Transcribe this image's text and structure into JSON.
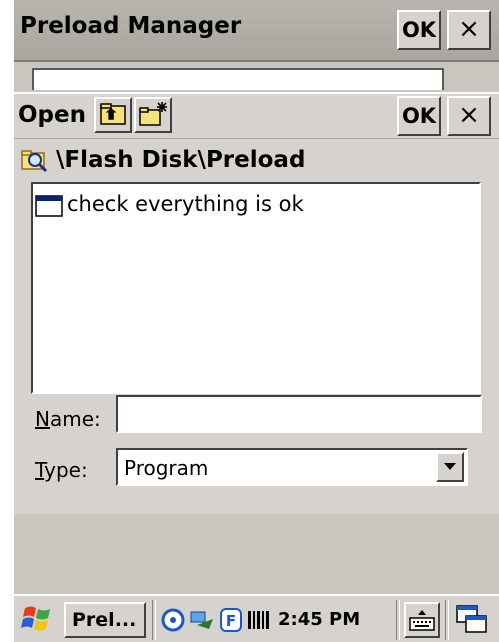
{
  "outer_window": {
    "title": "Preload Manager",
    "ok_label": "OK",
    "close_label": "×"
  },
  "dialog": {
    "title": "Open",
    "ok_label": "OK",
    "close_label": "×",
    "path": "\\Flash Disk\\Preload",
    "files": [
      {
        "name": "check everything is ok",
        "icon": "file-icon"
      }
    ],
    "name_label_first": "N",
    "name_label_rest": "ame:",
    "name_value": "",
    "type_label_first": "T",
    "type_label_rest": "ype:",
    "type_value": "Program"
  },
  "taskbar": {
    "task_label": "Prel...",
    "time": "2:45 PM"
  },
  "colors": {
    "face": "#d6d3ce",
    "title": "#a9a59f"
  }
}
